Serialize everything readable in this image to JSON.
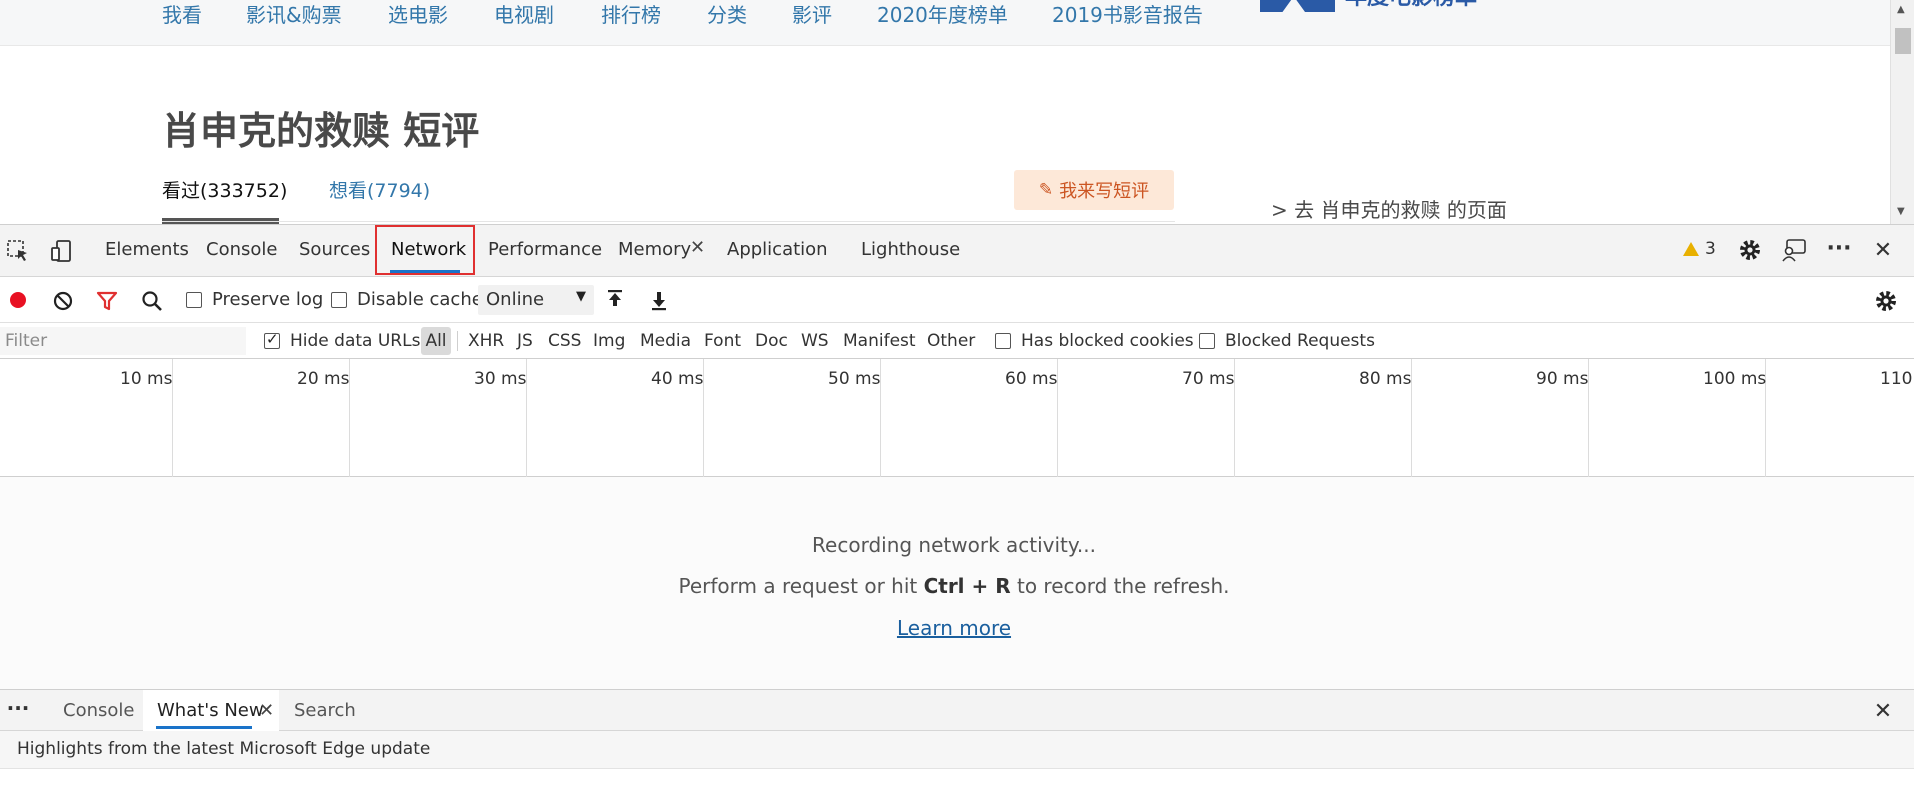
{
  "page": {
    "nav": [
      "我看",
      "影讯&购票",
      "选电影",
      "电视剧",
      "排行榜",
      "分类",
      "影评",
      "2020年度榜单",
      "2019书影音报告"
    ],
    "brand_text": "年度电影榜单",
    "title": "肖申克的救赎 短评",
    "tab_seen": "看过(333752)",
    "tab_want": "想看(7794)",
    "write_button": "我来写短评",
    "goto_link": "> 去 肖申克的救赎 的页面"
  },
  "devtools": {
    "tabs": {
      "elements": "Elements",
      "console": "Console",
      "sources": "Sources",
      "network": "Network",
      "performance": "Performance",
      "memory": "Memory",
      "application": "Application",
      "lighthouse": "Lighthouse"
    },
    "warning_count": "3",
    "toolbar": {
      "preserve_log": "Preserve log",
      "disable_cache": "Disable cache",
      "throttle_value": "Online"
    },
    "filter": {
      "placeholder": "Filter",
      "hide_data_urls": "Hide data URLs",
      "types": [
        "All",
        "XHR",
        "JS",
        "CSS",
        "Img",
        "Media",
        "Font",
        "Doc",
        "WS",
        "Manifest",
        "Other"
      ],
      "has_blocked_cookies": "Has blocked cookies",
      "blocked_requests": "Blocked Requests"
    },
    "timeline_labels": [
      "10 ms",
      "20 ms",
      "30 ms",
      "40 ms",
      "50 ms",
      "60 ms",
      "70 ms",
      "80 ms",
      "90 ms",
      "100 ms",
      "110"
    ],
    "empty_state": {
      "recording": "Recording network activity...",
      "hint_before": "Perform a request or hit ",
      "hint_keys": "Ctrl + R",
      "hint_after": " to record the refresh.",
      "learn_more": "Learn more"
    },
    "drawer": {
      "console": "Console",
      "whats_new": "What's New",
      "search": "Search",
      "subtitle": "Highlights from the latest Microsoft Edge update"
    },
    "colors": {
      "record_red": "#e81123",
      "filter_red": "#e03030",
      "accent_blue": "#1a73c9",
      "warning_yellow": "#e8b000"
    }
  }
}
